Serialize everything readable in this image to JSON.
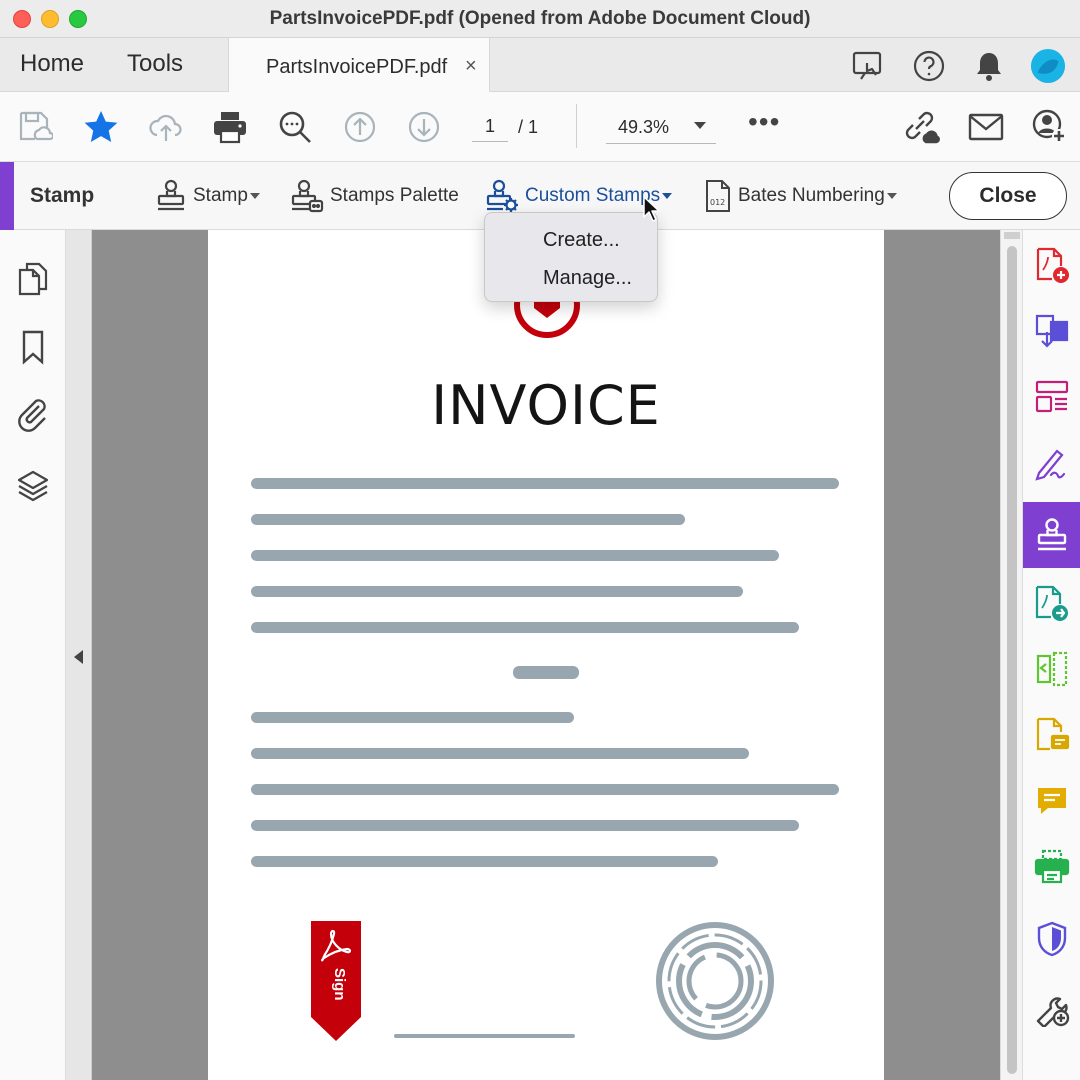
{
  "window": {
    "title": "PartsInvoicePDF.pdf (Opened from Adobe Document Cloud)"
  },
  "tabs": {
    "home": "Home",
    "tools": "Tools",
    "document": {
      "label": "PartsInvoicePDF.pdf",
      "close": "×"
    }
  },
  "toolbar": {
    "page_current": "1",
    "page_separator": "/ 1",
    "zoom": "49.3%",
    "more": "•••"
  },
  "stampbar": {
    "title": "Stamp",
    "items": [
      {
        "label": "Stamp"
      },
      {
        "label": "Stamps Palette"
      },
      {
        "label": "Custom Stamps"
      },
      {
        "label": "Bates Numbering"
      }
    ],
    "close_label": "Close"
  },
  "dropdown": {
    "items": [
      "Create...",
      "Manage..."
    ]
  },
  "document": {
    "heading": "INVOICE",
    "sign_label": "Sign"
  },
  "colors": {
    "accent_purple": "#7f3fd1",
    "adobe_red": "#c4000b",
    "text_line_gray": "#98a6b0",
    "link_blue": "#1b4f9c"
  }
}
